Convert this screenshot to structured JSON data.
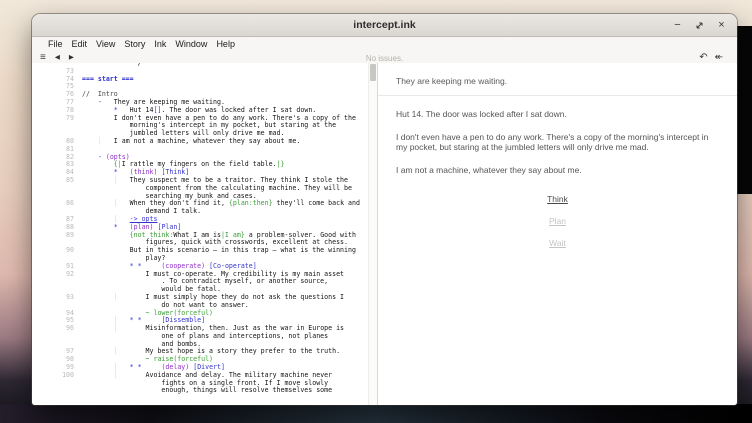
{
  "window": {
    "title": "intercept.ink",
    "controls": {
      "minimize": "−",
      "close": "×"
    }
  },
  "menu": {
    "items": [
      "File",
      "Edit",
      "View",
      "Story",
      "Ink",
      "Window",
      "Help"
    ]
  },
  "toolbar": {
    "status": "No issues.",
    "icons": {
      "menu": "≡",
      "back": "◀",
      "forward": "▶",
      "undo": "↶",
      "rewind": "↞"
    }
  },
  "colors": {
    "syntax_blue": "#3434cf",
    "syntax_purple": "#9130c9",
    "syntax_green": "#3c9e37",
    "titlebar_bg": "#e2dfda",
    "choice_dim": "#c4c4c4"
  },
  "editor": {
    "lines": [
      {
        "n": "",
        "seg": [
          {
            "t": "              /",
            "c": "t"
          }
        ]
      },
      {
        "n": "73",
        "seg": []
      },
      {
        "n": "74",
        "seg": [
          {
            "t": "=== start ===",
            "c": "k"
          }
        ]
      },
      {
        "n": "75",
        "seg": []
      },
      {
        "n": "76",
        "seg": [
          {
            "t": "//  Intro",
            "c": "c"
          }
        ]
      },
      {
        "n": "77",
        "seg": [
          {
            "t": "    ",
            "c": "t"
          },
          {
            "t": "-",
            "c": "b"
          },
          {
            "t": "   They are keeping me waiting.",
            "c": "t"
          }
        ]
      },
      {
        "n": "78",
        "seg": [
          {
            "t": "        ",
            "c": "t"
          },
          {
            "t": "*",
            "c": "b"
          },
          {
            "t": "   Hut 14",
            "c": "t"
          },
          {
            "t": "[]",
            "c": "b"
          },
          {
            "t": ". The door was locked after I sat down.",
            "c": "t"
          }
        ]
      },
      {
        "n": "79",
        "seg": [
          {
            "t": "        I don't even have a pen to do any work. There's a copy of the",
            "c": "t"
          }
        ]
      },
      {
        "n": "",
        "seg": [
          {
            "t": "            morning's intercept in my pocket, but staring at the",
            "c": "t"
          }
        ]
      },
      {
        "n": "",
        "seg": [
          {
            "t": "            jumbled letters will only drive me mad.",
            "c": "t"
          }
        ]
      },
      {
        "n": "80",
        "seg": [
          {
            "t": "    ",
            "c": "t"
          },
          {
            "t": "│",
            "c": "gd"
          },
          {
            "t": "   I am not a machine, whatever they say about me.",
            "c": "t"
          }
        ]
      },
      {
        "n": "81",
        "seg": []
      },
      {
        "n": "82",
        "seg": [
          {
            "t": "    ",
            "c": "t"
          },
          {
            "t": "- ",
            "c": "b"
          },
          {
            "t": "(opts)",
            "c": "p"
          }
        ]
      },
      {
        "n": "83",
        "seg": [
          {
            "t": "        ",
            "c": "t"
          },
          {
            "t": "{|",
            "c": "g"
          },
          {
            "t": "I rattle my fingers on the field table.",
            "c": "t"
          },
          {
            "t": "|}",
            "c": "g"
          }
        ]
      },
      {
        "n": "84",
        "seg": [
          {
            "t": "        ",
            "c": "t"
          },
          {
            "t": "*",
            "c": "b"
          },
          {
            "t": "   ",
            "c": "t"
          },
          {
            "t": "(think)",
            "c": "p"
          },
          {
            "t": " ",
            "c": "t"
          },
          {
            "t": "[Think]",
            "c": "b"
          }
        ]
      },
      {
        "n": "85",
        "seg": [
          {
            "t": "        ",
            "c": "t"
          },
          {
            "t": "│",
            "c": "gd"
          },
          {
            "t": "   They suspect me to be a traitor. They think I stole the",
            "c": "t"
          }
        ]
      },
      {
        "n": "",
        "seg": [
          {
            "t": "                component from the calculating machine. They will be",
            "c": "t"
          }
        ]
      },
      {
        "n": "",
        "seg": [
          {
            "t": "                searching my bunk and cases.",
            "c": "t"
          }
        ]
      },
      {
        "n": "86",
        "seg": [
          {
            "t": "        ",
            "c": "t"
          },
          {
            "t": "│",
            "c": "gd"
          },
          {
            "t": "   When they don't find it, ",
            "c": "t"
          },
          {
            "t": "{plan:then}",
            "c": "g"
          },
          {
            "t": " they'll come back and",
            "c": "t"
          }
        ]
      },
      {
        "n": "",
        "seg": [
          {
            "t": "                demand I talk.",
            "c": "t"
          }
        ]
      },
      {
        "n": "87",
        "seg": [
          {
            "t": "        ",
            "c": "t"
          },
          {
            "t": "│",
            "c": "gd"
          },
          {
            "t": "   ",
            "c": "t"
          },
          {
            "t": "-> opts",
            "c": "d"
          }
        ]
      },
      {
        "n": "88",
        "seg": [
          {
            "t": "        ",
            "c": "t"
          },
          {
            "t": "*",
            "c": "b"
          },
          {
            "t": "   ",
            "c": "t"
          },
          {
            "t": "(plan)",
            "c": "p"
          },
          {
            "t": " ",
            "c": "t"
          },
          {
            "t": "[Plan]",
            "c": "b"
          }
        ]
      },
      {
        "n": "89",
        "seg": [
          {
            "t": "            ",
            "c": "t"
          },
          {
            "t": "{not think:",
            "c": "g"
          },
          {
            "t": "What I am is",
            "c": "t"
          },
          {
            "t": "|I am}",
            "c": "g"
          },
          {
            "t": " a problem-solver. Good with",
            "c": "t"
          }
        ]
      },
      {
        "n": "",
        "seg": [
          {
            "t": "                figures, quick with crosswords, excellent at chess.",
            "c": "t"
          }
        ]
      },
      {
        "n": "90",
        "seg": [
          {
            "t": "            But in this scenario — in this trap — what is the winning",
            "c": "t"
          }
        ]
      },
      {
        "n": "",
        "seg": [
          {
            "t": "                play?",
            "c": "t"
          }
        ]
      },
      {
        "n": "91",
        "seg": [
          {
            "t": "            ",
            "c": "t"
          },
          {
            "t": "* *",
            "c": "b"
          },
          {
            "t": "     ",
            "c": "t"
          },
          {
            "t": "(cooperate)",
            "c": "p"
          },
          {
            "t": " ",
            "c": "t"
          },
          {
            "t": "[Co-operate]",
            "c": "b"
          }
        ]
      },
      {
        "n": "92",
        "seg": [
          {
            "t": "                I must co-operate. My credibility is my main asset",
            "c": "t"
          }
        ]
      },
      {
        "n": "",
        "seg": [
          {
            "t": "                    . To contradict myself, or another source,",
            "c": "t"
          }
        ]
      },
      {
        "n": "",
        "seg": [
          {
            "t": "                    would be fatal.",
            "c": "t"
          }
        ]
      },
      {
        "n": "93",
        "seg": [
          {
            "t": "        ",
            "c": "t"
          },
          {
            "t": "│",
            "c": "gd"
          },
          {
            "t": "       I must simply hope they do not ask the questions I",
            "c": "t"
          }
        ]
      },
      {
        "n": "",
        "seg": [
          {
            "t": "                    do not want to answer.",
            "c": "t"
          }
        ]
      },
      {
        "n": "94",
        "seg": [
          {
            "t": "                ",
            "c": "t"
          },
          {
            "t": "~ lower(forceful)",
            "c": "g"
          }
        ]
      },
      {
        "n": "95",
        "seg": [
          {
            "t": "        ",
            "c": "t"
          },
          {
            "t": "│",
            "c": "gd"
          },
          {
            "t": "   ",
            "c": "t"
          },
          {
            "t": "* *",
            "c": "b"
          },
          {
            "t": "     ",
            "c": "t"
          },
          {
            "t": "[Dissemble]",
            "c": "b"
          }
        ]
      },
      {
        "n": "96",
        "seg": [
          {
            "t": "        ",
            "c": "t"
          },
          {
            "t": "│",
            "c": "gd"
          },
          {
            "t": "       Misinformation, then. Just as the war in Europe is",
            "c": "t"
          }
        ]
      },
      {
        "n": "",
        "seg": [
          {
            "t": "                    one of plans and interceptions, not planes",
            "c": "t"
          }
        ]
      },
      {
        "n": "",
        "seg": [
          {
            "t": "                    and bombs.",
            "c": "t"
          }
        ]
      },
      {
        "n": "97",
        "seg": [
          {
            "t": "        ",
            "c": "t"
          },
          {
            "t": "│",
            "c": "gd"
          },
          {
            "t": "       My best hope is a story they prefer to the truth.",
            "c": "t"
          }
        ]
      },
      {
        "n": "98",
        "seg": [
          {
            "t": "                ",
            "c": "t"
          },
          {
            "t": "~ raise(forceful)",
            "c": "g"
          }
        ]
      },
      {
        "n": "99",
        "seg": [
          {
            "t": "        ",
            "c": "t"
          },
          {
            "t": "│",
            "c": "gd"
          },
          {
            "t": "   ",
            "c": "t"
          },
          {
            "t": "* *",
            "c": "b"
          },
          {
            "t": "     ",
            "c": "t"
          },
          {
            "t": "(delay)",
            "c": "p"
          },
          {
            "t": " ",
            "c": "t"
          },
          {
            "t": "[Divert]",
            "c": "b"
          }
        ]
      },
      {
        "n": "100",
        "seg": [
          {
            "t": "        ",
            "c": "t"
          },
          {
            "t": "│",
            "c": "gd"
          },
          {
            "t": "       Avoidance and delay. The military machine never",
            "c": "t"
          }
        ]
      },
      {
        "n": "",
        "seg": [
          {
            "t": "                    fights on a single front. If I move slowly",
            "c": "t"
          }
        ]
      },
      {
        "n": "",
        "seg": [
          {
            "t": "                    enough, things will resolve themselves some",
            "c": "t"
          }
        ]
      }
    ]
  },
  "player": {
    "intro": "They are keeping me waiting.",
    "paragraphs": [
      "Hut 14. The door was locked after I sat down.",
      "I don't even have a pen to do any work. There's a copy of the morning's intercept in my pocket, but staring at the jumbled letters will only drive me mad.",
      "I am not a machine, whatever they say about me."
    ],
    "choices": [
      {
        "label": "Think",
        "state": "active"
      },
      {
        "label": "Plan",
        "state": "dim"
      },
      {
        "label": "Wait",
        "state": "dim"
      }
    ]
  }
}
